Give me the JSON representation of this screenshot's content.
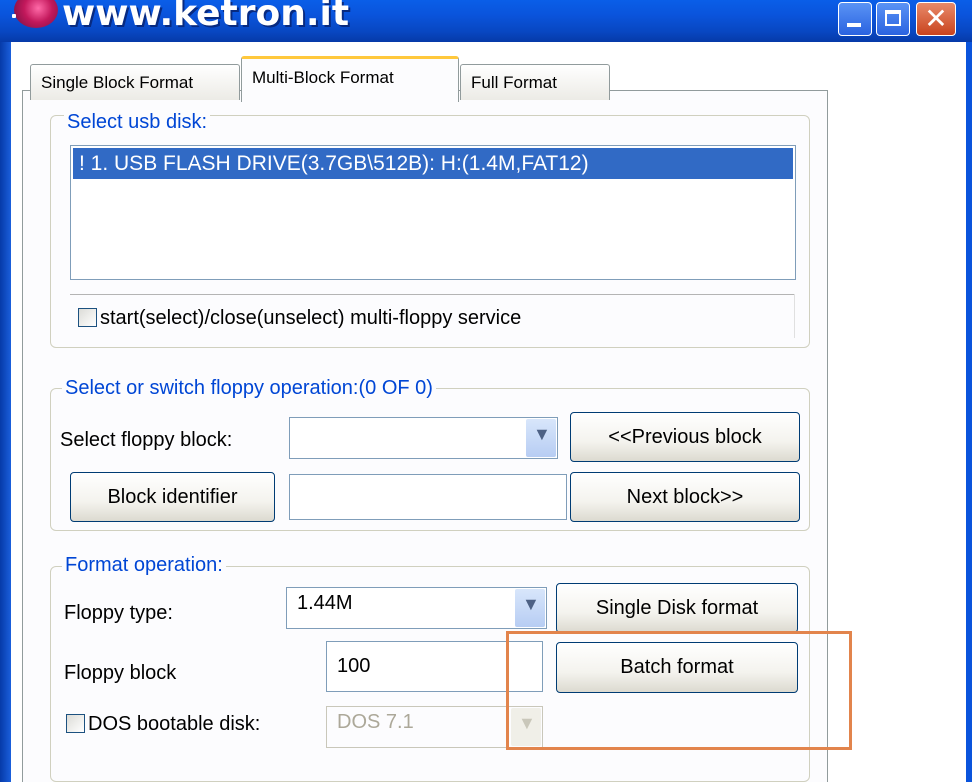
{
  "window": {
    "title": "www.ketron.it"
  },
  "tabs": [
    "Single Block Format",
    "Multi-Block Format",
    "Full Format"
  ],
  "usb_group": {
    "label": "Select usb disk:",
    "items": [
      "! 1. USB FLASH DRIVE(3.7GB\\512B): H:(1.4M,FAT12)"
    ],
    "service_checkbox_label": "start(select)/close(unselect) multi-floppy service"
  },
  "floppy_group": {
    "label": "Select or switch floppy operation:(0 OF 0)",
    "select_block_label": "Select floppy block:",
    "select_block_value": "",
    "prev_button": "<<Previous block",
    "block_identifier_button": "Block identifier",
    "block_identifier_value": "",
    "next_button": "Next block>>"
  },
  "format_group": {
    "label": "Format operation:",
    "floppy_type_label": "Floppy type:",
    "floppy_type_value": "1.44M",
    "single_format_button": "Single Disk format",
    "floppy_block_label": "Floppy block",
    "floppy_block_value": "100",
    "batch_format_button": "Batch format",
    "dos_checkbox_label": "DOS bootable disk:",
    "dos_version_value": "DOS 7.1"
  },
  "colors": {
    "titlebar": "#0a54dc",
    "selection": "#316ac5",
    "group_label": "#0046d5",
    "highlight": "#e2844c"
  },
  "icons": {
    "chevron": "chevron-down-icon",
    "app": "app-icon"
  }
}
